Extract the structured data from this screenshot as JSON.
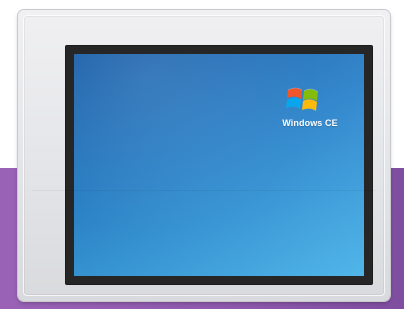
{
  "os_logo": {
    "text": "Windows CE",
    "icon": "windows-flag-icon",
    "colors": {
      "red": "#f25022",
      "green": "#7fba00",
      "blue": "#00a4ef",
      "yellow": "#ffb900"
    }
  },
  "colors": {
    "purple_background": "#8f5aad",
    "bezel": "#262626",
    "screen_start": "#1d63b0",
    "screen_end": "#47b2e8",
    "frame": "#e6e7ea"
  }
}
